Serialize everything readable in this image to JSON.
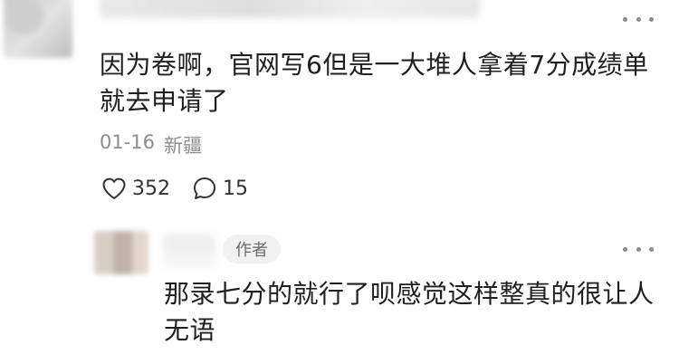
{
  "comment": {
    "text_line1": "因为卷啊，官网写6但是一大堆人拿着7分成绩单",
    "text_line2": "就去申请了",
    "date": "01-16",
    "location": "新疆",
    "likes": "352",
    "replies": "15"
  },
  "reply": {
    "badge": "作者",
    "text_line1": "那录七分的就行了呗感觉这样整真的很让人",
    "text_line2": "无语"
  },
  "colors": {
    "text": "#1f1f1f",
    "meta": "#8d8d8d",
    "badge_bg": "#f1f1f1"
  },
  "icons": [
    "heart-icon",
    "comment-bubble-icon",
    "more-icon"
  ]
}
